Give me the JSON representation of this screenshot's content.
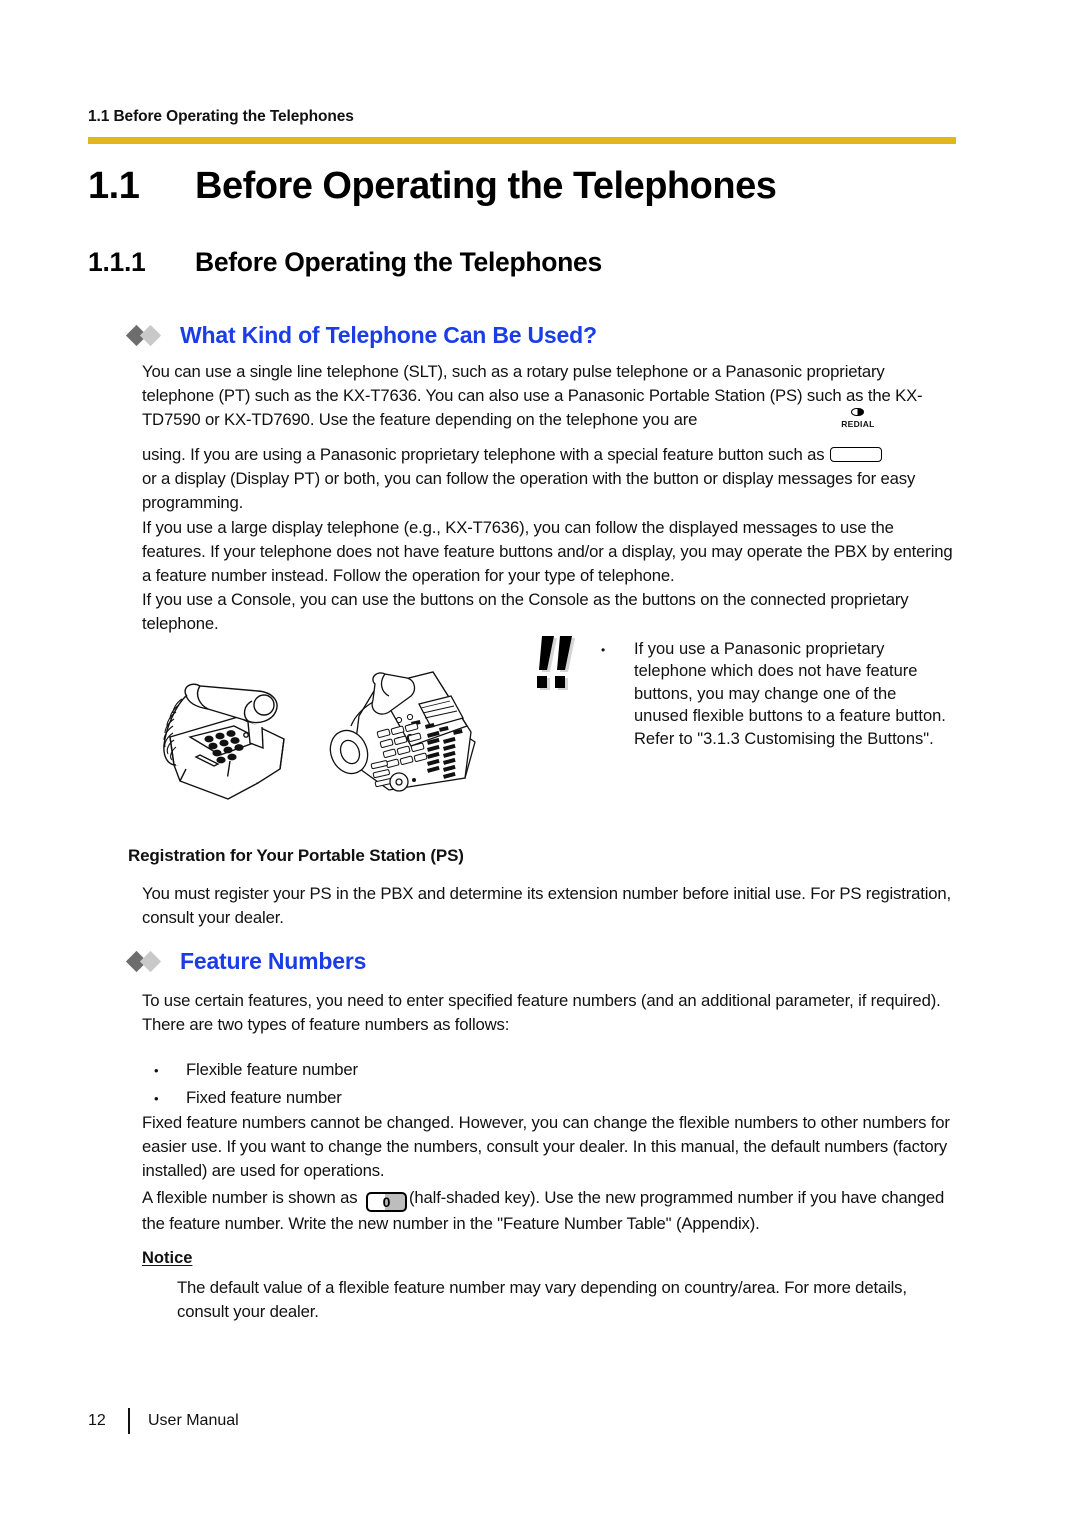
{
  "colors": {
    "rule_gold": "#e0b81a",
    "heading_blue": "#1a3de8",
    "diamond_dark": "#6d6d6d",
    "diamond_light": "#c9c9c9",
    "text": "#111111"
  },
  "running_header": "1.1 Before Operating the Telephones",
  "h1": {
    "number": "1.1",
    "title": "Before Operating the Telephones"
  },
  "h2": {
    "number": "1.1.1",
    "title": "Before Operating the Telephones"
  },
  "section_what": {
    "heading": "What Kind of Telephone Can Be Used?",
    "para1": "You can use a single line telephone (SLT), such as a rotary pulse telephone or a Panasonic proprietary telephone (PT) such as the KX-T7636. You can also use a Panasonic Portable Station (PS) such as the KX-TD7590 or KX-TD7690. Use the feature depending on the telephone you are",
    "para2_before_key": "using. If you are using a Panasonic proprietary telephone with a special feature button such as ",
    "para2_after_key": "or a display (Display PT) or both, you can follow the operation with the button or display messages for easy programming.",
    "para3": "If you use a large display telephone (e.g., KX-T7636), you can follow the displayed messages to use the features. If your telephone does not have feature buttons and/or a display, you may operate the PBX by entering a feature number instead. Follow the operation for your type of telephone.",
    "para4": "If you use a Console, you can use the buttons on the Console as the buttons on the connected proprietary telephone."
  },
  "redial_key": {
    "symbol_name": "half-filled-circle",
    "caption": "REDIAL"
  },
  "callout": {
    "icon_name": "double-exclamation-notice-icon",
    "bullet": "•",
    "text": "If you use a Panasonic proprietary telephone which does not have feature buttons, you may change one of the unused flexible buttons to a feature button. Refer to \"3.1.3 Customising the Buttons\"."
  },
  "illustrations": [
    {
      "name": "single-line-telephone-illustration",
      "caption": ""
    },
    {
      "name": "proprietary-telephone-illustration",
      "caption": ""
    }
  ],
  "registration": {
    "heading": "Registration for Your Portable Station (PS)",
    "body": "You must register your PS in the PBX and determine its extension number before initial use. For PS registration, consult your dealer."
  },
  "section_feature": {
    "heading": "Feature Numbers",
    "para1": "To use certain features, you need to enter specified feature numbers (and an additional parameter, if required).",
    "para2": "There are two types of feature numbers as follows:",
    "bullets": [
      "Flexible feature number",
      "Fixed feature number"
    ],
    "para3": "Fixed feature numbers cannot be changed. However, you can change the flexible numbers to other numbers for easier use. If you want to change the numbers, consult your dealer. In this manual, the default numbers (factory installed) are used for operations.",
    "para4_before_key": "A flexible number is shown as ",
    "zero_key_label": "0",
    "para4_after_key": "(half-shaded key). Use the new programmed number if you have changed the feature number. Write the new number in the \"Feature Number Table\" (Appendix)."
  },
  "notice": {
    "heading": "Notice",
    "body": "The default value of a flexible feature number may vary depending on country/area. For more details, consult your dealer."
  },
  "footer": {
    "page_number": "12",
    "label": "User Manual"
  }
}
